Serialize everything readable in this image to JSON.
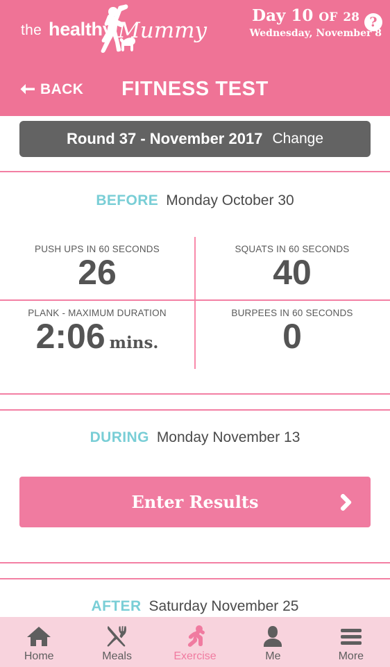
{
  "brand": {
    "logo_the": "the",
    "logo_healthy": "healthy",
    "logo_mummy": "Mummy",
    "pink": "#ef7396",
    "teal": "#79ced6",
    "gray_bar": "#636363",
    "nav_bg": "#f8d3dd"
  },
  "header": {
    "day_prefix": "Day",
    "day_number": "10",
    "day_of": "OF",
    "day_total": "28",
    "date_line": "Wednesday, November 8",
    "help_icon": "question-mark-icon",
    "help_glyph": "?",
    "back_label": "BACK",
    "back_icon": "arrow-left-icon",
    "title": "FITNESS TEST"
  },
  "round": {
    "label": "Round 37 - November 2017",
    "change_label": "Change"
  },
  "sections": {
    "before": {
      "tag": "BEFORE",
      "date": "Monday October 30",
      "stats": [
        {
          "label": "PUSH UPS IN 60 SECONDS",
          "value": "26",
          "unit": ""
        },
        {
          "label": "SQUATS IN 60 SECONDS",
          "value": "40",
          "unit": ""
        },
        {
          "label": "PLANK - MAXIMUM DURATION",
          "value": "2:06",
          "unit": "mins."
        },
        {
          "label": "BURPEES IN 60 SECONDS",
          "value": "0",
          "unit": ""
        }
      ]
    },
    "during": {
      "tag": "DURING",
      "date": "Monday November 13",
      "button_label": "Enter Results",
      "button_icon": "chevron-right-icon"
    },
    "after": {
      "tag": "AFTER",
      "date": "Saturday November 25"
    }
  },
  "bottom_nav": {
    "items": [
      {
        "label": "Home",
        "icon": "home-icon",
        "active": false
      },
      {
        "label": "Meals",
        "icon": "cutlery-icon",
        "active": false
      },
      {
        "label": "Exercise",
        "icon": "running-person-icon",
        "active": true
      },
      {
        "label": "Me",
        "icon": "person-icon",
        "active": false
      },
      {
        "label": "More",
        "icon": "hamburger-menu-icon",
        "active": false
      }
    ]
  }
}
